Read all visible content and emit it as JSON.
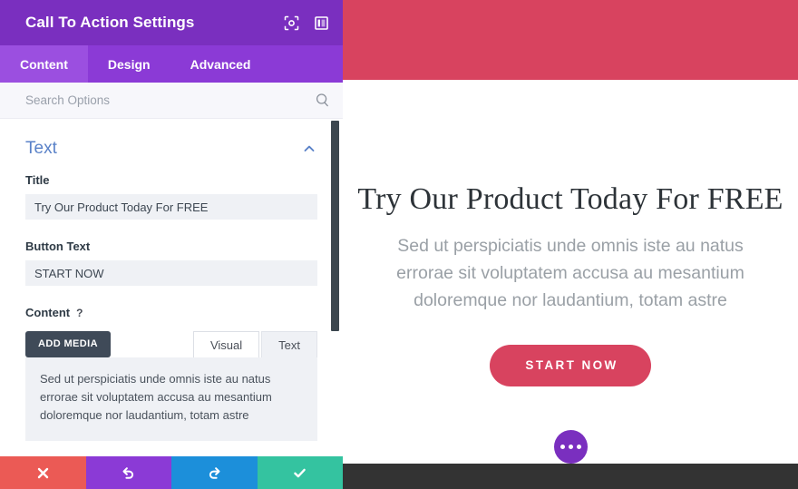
{
  "settings": {
    "header": {
      "title": "Call To Action Settings",
      "icons": [
        {
          "name": "fullscreen-icon",
          "glyph": "expand"
        },
        {
          "name": "layout-panel-icon",
          "glyph": "panel"
        }
      ]
    },
    "tabs": [
      {
        "label": "Content",
        "active": true
      },
      {
        "label": "Design",
        "active": false
      },
      {
        "label": "Advanced",
        "active": false
      }
    ],
    "search": {
      "placeholder": "Search Options",
      "value": "",
      "icon": "search-icon"
    },
    "section": {
      "title": "Text",
      "collapse_icon": "chevron-up-icon",
      "title_color": "#5A82C8"
    },
    "fields": {
      "title_label": "Title",
      "title_value": "Try Our Product Today For FREE",
      "button_text_label": "Button Text",
      "button_text_value": "START NOW",
      "content_label": "Content",
      "content_help": "?",
      "add_media_label": "ADD MEDIA",
      "editor_tabs": [
        {
          "label": "Visual",
          "active": true
        },
        {
          "label": "Text",
          "active": false
        }
      ],
      "content_value": "Sed ut perspiciatis unde omnis iste au natus errorae sit voluptatem accusa au mesantium doloremque nor laudantium, totam astre"
    },
    "actions": [
      {
        "name": "close-button",
        "icon": "close-icon",
        "color": "#EB5A55"
      },
      {
        "name": "undo-button",
        "icon": "undo-icon",
        "color": "#8B3AD6"
      },
      {
        "name": "redo-button",
        "icon": "redo-icon",
        "color": "#1C8FDA"
      },
      {
        "name": "save-button",
        "icon": "check-icon",
        "color": "#34C3A0"
      }
    ]
  },
  "preview": {
    "topbar_color": "#D8435F",
    "heading": "Try Our Product Today For FREE",
    "body": "Sed ut perspiciatis unde omnis iste au natus errorae sit voluptatem accusa au mesantium doloremque nor laudantium, totam astre",
    "cta_label": "START NOW",
    "cta_color": "#D8435F",
    "fab_icon": "ellipsis-icon",
    "fab_color": "#7A2FBF",
    "bottombar_color": "#333333"
  },
  "colors": {
    "header_purple": "#7A2FBF",
    "tab_purple": "#8B3AD6",
    "tab_active_purple": "#9B4FE0",
    "accent_blue": "#5A82C8"
  }
}
